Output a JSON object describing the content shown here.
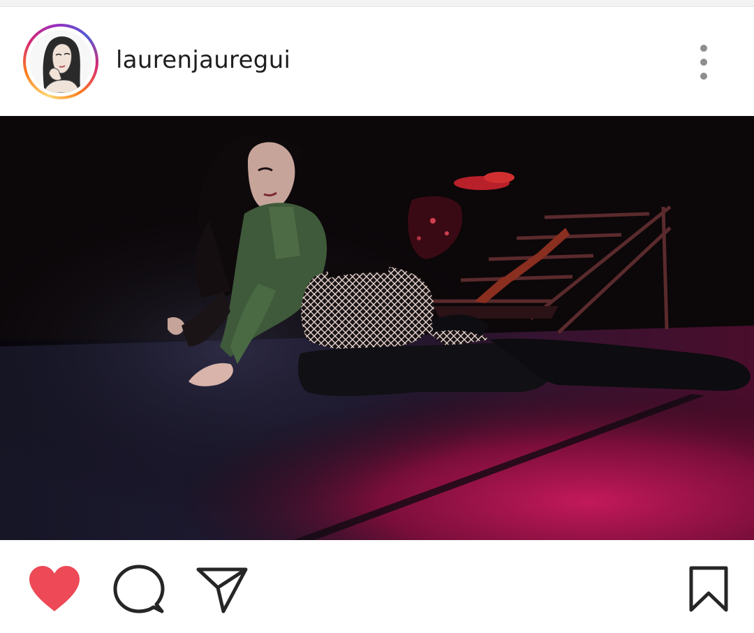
{
  "post": {
    "username": "laurenjauregui"
  },
  "icons": {
    "avatar": "avatar-portrait",
    "more": "more-options-icon",
    "like": "heart-icon",
    "comment": "comment-icon",
    "share": "send-icon",
    "save": "bookmark-icon"
  },
  "state": {
    "liked": true,
    "saved": false
  },
  "colors": {
    "like_red": "#ed4956",
    "icon_dark": "#262626",
    "muted": "#8e8e8e"
  }
}
